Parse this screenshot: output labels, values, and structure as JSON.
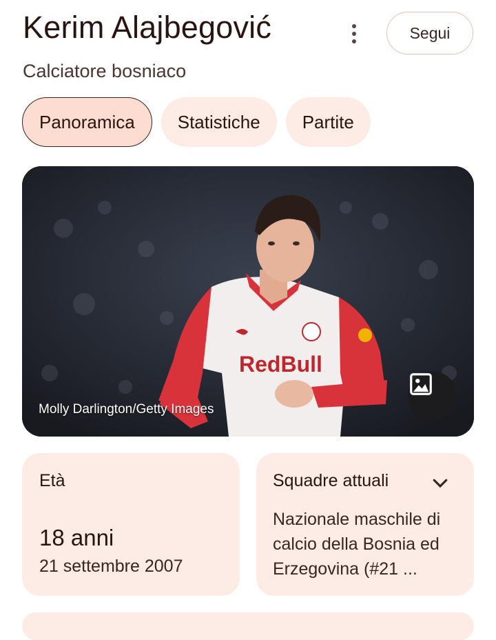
{
  "header": {
    "name": "Kerim Alajbegović",
    "subtitle": "Calciatore bosniaco",
    "follow_label": "Segui"
  },
  "tabs": [
    {
      "label": "Panoramica",
      "active": true
    },
    {
      "label": "Statistiche",
      "active": false
    },
    {
      "label": "Partite",
      "active": false
    }
  ],
  "hero": {
    "credit": "Molly Darlington/Getty Images",
    "jersey_sponsor": "RedBull"
  },
  "age_card": {
    "label": "Età",
    "value": "18 anni",
    "birthdate": "21 settembre 2007"
  },
  "team_card": {
    "label": "Squadre attuali",
    "value": "Nazionale maschile di calcio della Bosnia ed Erzegovina (#21 ..."
  },
  "icons": {
    "more": "more-vert-icon",
    "image": "image-icon",
    "expand": "chevron-down-icon"
  },
  "colors": {
    "chip_bg": "#fdebe5",
    "chip_active_bg": "#fdddd2",
    "text": "#2a1410"
  }
}
